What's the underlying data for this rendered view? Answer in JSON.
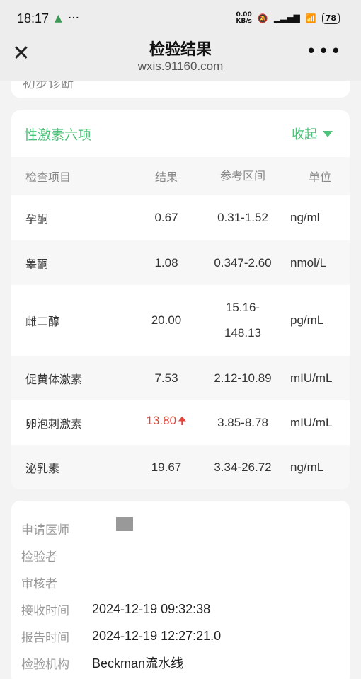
{
  "status_bar": {
    "time": "18:17",
    "net_speed_value": "0.00",
    "net_speed_unit": "KB/s",
    "battery": "78",
    "colors": {
      "mini_icon": "#3a9a55"
    }
  },
  "nav": {
    "title": "检验结果",
    "subtitle": "wxis.91160.com",
    "close_icon": "close-icon",
    "more_icon": "more-icon"
  },
  "prev_card": {
    "text": "初步诊断"
  },
  "report": {
    "title": "性激素六项",
    "collapse_label": "收起",
    "accent_color": "#4cc17a",
    "abnormal_color": "#e0453a",
    "columns": [
      "检查项目",
      "结果",
      "参考区间",
      "单位"
    ],
    "rows": [
      {
        "name": "孕酮",
        "result": "0.67",
        "ref": "0.31-1.52",
        "unit": "ng/ml",
        "flag": ""
      },
      {
        "name": "睾酮",
        "result": "1.08",
        "ref": "0.347-2.60",
        "unit": "nmol/L",
        "flag": ""
      },
      {
        "name": "雌二醇",
        "result": "20.00",
        "ref_line1": "15.16-",
        "ref_line2": "148.13",
        "unit": "pg/mL",
        "flag": ""
      },
      {
        "name": "促黄体激素",
        "result": "7.53",
        "ref": "2.12-10.89",
        "unit": "mIU/mL",
        "flag": ""
      },
      {
        "name": "卵泡刺激素",
        "result": "13.80",
        "ref": "3.85-8.78",
        "unit": "mIU/mL",
        "flag": "up"
      },
      {
        "name": "泌乳素",
        "result": "19.67",
        "ref": "3.34-26.72",
        "unit": "ng/mL",
        "flag": ""
      }
    ]
  },
  "info": {
    "rows": [
      {
        "label": "申请医师",
        "value": ""
      },
      {
        "label": "检验者",
        "value": ""
      },
      {
        "label": "审核者",
        "value": ""
      },
      {
        "label": "接收时间",
        "value": "2024-12-19 09:32:38"
      },
      {
        "label": "报告时间",
        "value": "2024-12-19 12:27:21.0"
      },
      {
        "label": "检验机构",
        "value": "Beckman流水线"
      }
    ]
  }
}
